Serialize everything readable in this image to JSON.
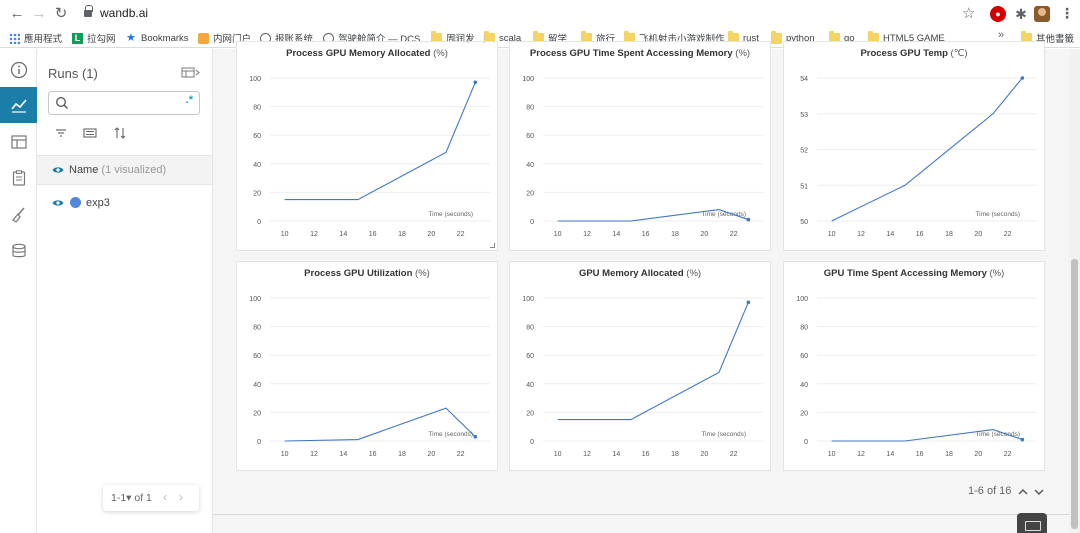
{
  "browser": {
    "url": "wandb.ai",
    "bookmarks": [
      {
        "label": "應用程式",
        "icon": "apps-grid-icon"
      },
      {
        "label": "拉勾网",
        "icon": "lagou-icon"
      },
      {
        "label": "Bookmarks",
        "icon": "star-icon"
      },
      {
        "label": "内网门户",
        "icon": "orange-site-icon"
      },
      {
        "label": "报账系统",
        "icon": "globe-icon"
      },
      {
        "label": "驾驶舱简介 — DCS...",
        "icon": "globe-icon"
      },
      {
        "label": "周润发",
        "icon": "folder-icon"
      },
      {
        "label": "scala",
        "icon": "folder-icon"
      },
      {
        "label": "留学",
        "icon": "folder-icon"
      },
      {
        "label": "旅行",
        "icon": "folder-icon"
      },
      {
        "label": "飞机射击小游戏制作",
        "icon": "folder-icon"
      },
      {
        "label": "rust",
        "icon": "folder-icon"
      },
      {
        "label": "python",
        "icon": "folder-icon"
      },
      {
        "label": "go",
        "icon": "folder-icon"
      },
      {
        "label": "HTML5 GAME",
        "icon": "folder-icon"
      },
      {
        "label": "»",
        "icon": "more-chevron"
      },
      {
        "label": "其他書籤",
        "icon": "folder-icon"
      }
    ]
  },
  "runs_panel": {
    "title": "Runs (1)",
    "search_placeholder": "",
    "regex_label": ".*",
    "name_header": "Name",
    "name_header_suffix": "(1 visualized)",
    "runs": [
      {
        "name": "exp3",
        "color": "#5387dd"
      }
    ],
    "pager": {
      "label": "1-1▾ of 1",
      "prev": "‹",
      "next": "›"
    }
  },
  "main": {
    "page_count": "1-6 of 16"
  },
  "chart_data": [
    {
      "type": "line",
      "title": "Process GPU Memory Allocated",
      "unit": "(%)",
      "xlabel": "Time (seconds)",
      "xlim": [
        9,
        24
      ],
      "ylim": [
        0,
        100
      ],
      "xticks": [
        10,
        12,
        14,
        16,
        18,
        20,
        22
      ],
      "yticks": [
        0,
        20,
        40,
        60,
        80,
        100
      ],
      "series": [
        {
          "color": "#3f77c6",
          "x": [
            10,
            15,
            21,
            23
          ],
          "y": [
            15,
            15,
            48,
            97
          ]
        }
      ]
    },
    {
      "type": "line",
      "title": "Process GPU Time Spent Accessing Memory",
      "unit": "(%)",
      "xlabel": "Time (seconds)",
      "xlim": [
        9,
        24
      ],
      "ylim": [
        0,
        100
      ],
      "xticks": [
        10,
        12,
        14,
        16,
        18,
        20,
        22
      ],
      "yticks": [
        0,
        20,
        40,
        60,
        80,
        100
      ],
      "series": [
        {
          "color": "#3f77c6",
          "x": [
            10,
            15,
            21,
            23
          ],
          "y": [
            0,
            0,
            8,
            1
          ]
        }
      ]
    },
    {
      "type": "line",
      "title": "Process GPU Temp",
      "unit": "(℃)",
      "xlabel": "Time (seconds)",
      "xlim": [
        9,
        24
      ],
      "ylim": [
        50,
        54
      ],
      "xticks": [
        10,
        12,
        14,
        16,
        18,
        20,
        22
      ],
      "yticks": [
        50,
        51,
        52,
        53,
        54
      ],
      "series": [
        {
          "color": "#3f77c6",
          "x": [
            10,
            15,
            21,
            23
          ],
          "y": [
            50,
            51,
            53,
            54
          ]
        }
      ]
    },
    {
      "type": "line",
      "title": "Process GPU Utilization",
      "unit": "(%)",
      "xlabel": "Time (seconds)",
      "xlim": [
        9,
        24
      ],
      "ylim": [
        0,
        100
      ],
      "xticks": [
        10,
        12,
        14,
        16,
        18,
        20,
        22
      ],
      "yticks": [
        0,
        20,
        40,
        60,
        80,
        100
      ],
      "series": [
        {
          "color": "#3f77c6",
          "x": [
            10,
            15,
            21,
            23
          ],
          "y": [
            0,
            1,
            23,
            3
          ]
        }
      ]
    },
    {
      "type": "line",
      "title": "GPU Memory Allocated",
      "unit": "(%)",
      "xlabel": "Time (seconds)",
      "xlim": [
        9,
        24
      ],
      "ylim": [
        0,
        100
      ],
      "xticks": [
        10,
        12,
        14,
        16,
        18,
        20,
        22
      ],
      "yticks": [
        0,
        20,
        40,
        60,
        80,
        100
      ],
      "series": [
        {
          "color": "#3f77c6",
          "x": [
            10,
            15,
            21,
            23
          ],
          "y": [
            15,
            15,
            48,
            97
          ]
        }
      ]
    },
    {
      "type": "line",
      "title": "GPU Time Spent Accessing Memory",
      "unit": "(%)",
      "xlabel": "Time (seconds)",
      "xlim": [
        9,
        24
      ],
      "ylim": [
        0,
        100
      ],
      "xticks": [
        10,
        12,
        14,
        16,
        18,
        20,
        22
      ],
      "yticks": [
        0,
        20,
        40,
        60,
        80,
        100
      ],
      "series": [
        {
          "color": "#3f77c6",
          "x": [
            10,
            15,
            21,
            23
          ],
          "y": [
            0,
            0,
            8,
            1
          ]
        }
      ]
    }
  ]
}
